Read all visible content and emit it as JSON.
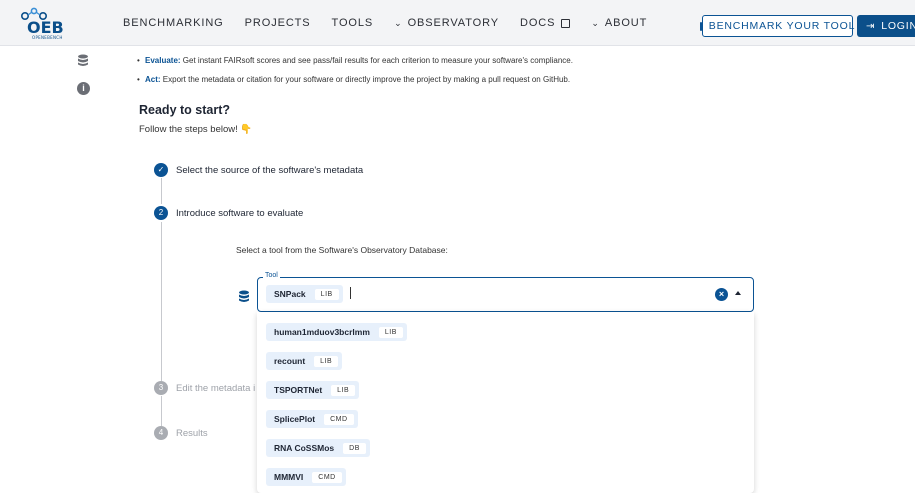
{
  "header": {
    "logo_text": "OPENEBENCH",
    "nav": [
      {
        "label": "BENCHMARKING",
        "type": "link"
      },
      {
        "label": "PROJECTS",
        "type": "link"
      },
      {
        "label": "TOOLS",
        "type": "link"
      },
      {
        "label": "OBSERVATORY",
        "type": "dropdown"
      },
      {
        "label": "DOCS",
        "type": "external"
      },
      {
        "label": "ABOUT",
        "type": "dropdown"
      }
    ],
    "benchmark_button": "BENCHMARK YOUR TOOL",
    "login_button": "LOGIN"
  },
  "sidebar": {
    "icons": [
      "database-icon",
      "info-icon"
    ]
  },
  "intro": {
    "bullets": [
      {
        "strong": "Evaluate:",
        "text": " Get instant FAIRsoft scores and see pass/fail results for each criterion to measure your software's compliance."
      },
      {
        "strong": "Act:",
        "text": " Export the metadata or citation for your software or directly improve the project by making a pull request on GitHub."
      }
    ],
    "title": "Ready to start?",
    "subtitle": "Follow the steps below!",
    "subtitle_emoji": "👇"
  },
  "steps": [
    {
      "number": "✓",
      "label": "Select the source of the software's metadata",
      "state": "done"
    },
    {
      "number": "2",
      "label": "Introduce software to evaluate",
      "state": "active"
    },
    {
      "number": "3",
      "label": "Edit the metadata i",
      "state": "idle"
    },
    {
      "number": "4",
      "label": "Results",
      "state": "idle"
    }
  ],
  "tool_select": {
    "prompt": "Select a tool from the Software's Observatory Database:",
    "field_label": "Tool",
    "selected": {
      "name": "SNPack",
      "type": "LIB"
    },
    "input_value": "",
    "options": [
      {
        "name": "human1mduov3bcrlmm",
        "type": "LIB"
      },
      {
        "name": "recount",
        "type": "LIB"
      },
      {
        "name": "TSPORTNet",
        "type": "LIB"
      },
      {
        "name": "SplicePlot",
        "type": "CMD"
      },
      {
        "name": "RNA CoSSMos",
        "type": "DB"
      },
      {
        "name": "MMMVI",
        "type": "CMD"
      }
    ]
  },
  "colors": {
    "accent": "#0b5394",
    "header_bg": "#f3f4f6",
    "chip_bg": "#e7f0fb",
    "step_idle": "#a9acb2"
  }
}
